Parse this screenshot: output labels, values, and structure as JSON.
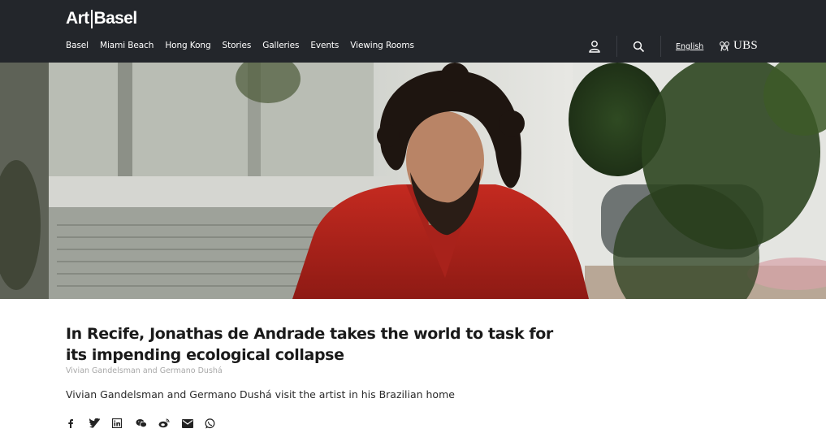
{
  "header": {
    "logo": {
      "left": "Art",
      "right": "Basel"
    },
    "nav": [
      "Basel",
      "Miami Beach",
      "Hong Kong",
      "Stories",
      "Galleries",
      "Events",
      "Viewing Rooms"
    ],
    "language": "English",
    "sponsor": "UBS",
    "icons": [
      "user-icon",
      "search-icon",
      "ubs-keys-icon"
    ]
  },
  "hero": {
    "alt_description_shown": ""
  },
  "article": {
    "title": "In Recife, Jonathas de Andrade takes the world to task for its impending ecological collapse",
    "byline": "Vivian Gandelsman and Germano Dushá",
    "dek": "Vivian Gandelsman and Germano Dushá visit the artist in his Brazilian home",
    "share": [
      "facebook-icon",
      "twitter-icon",
      "linkedin-icon",
      "wechat-icon",
      "weibo-icon",
      "email-icon",
      "whatsapp-icon"
    ]
  },
  "colors": {
    "header_bg": "#23262b",
    "text": "#1a1a1a",
    "byline": "#a8a8a8",
    "shirt": "#b8231c"
  }
}
